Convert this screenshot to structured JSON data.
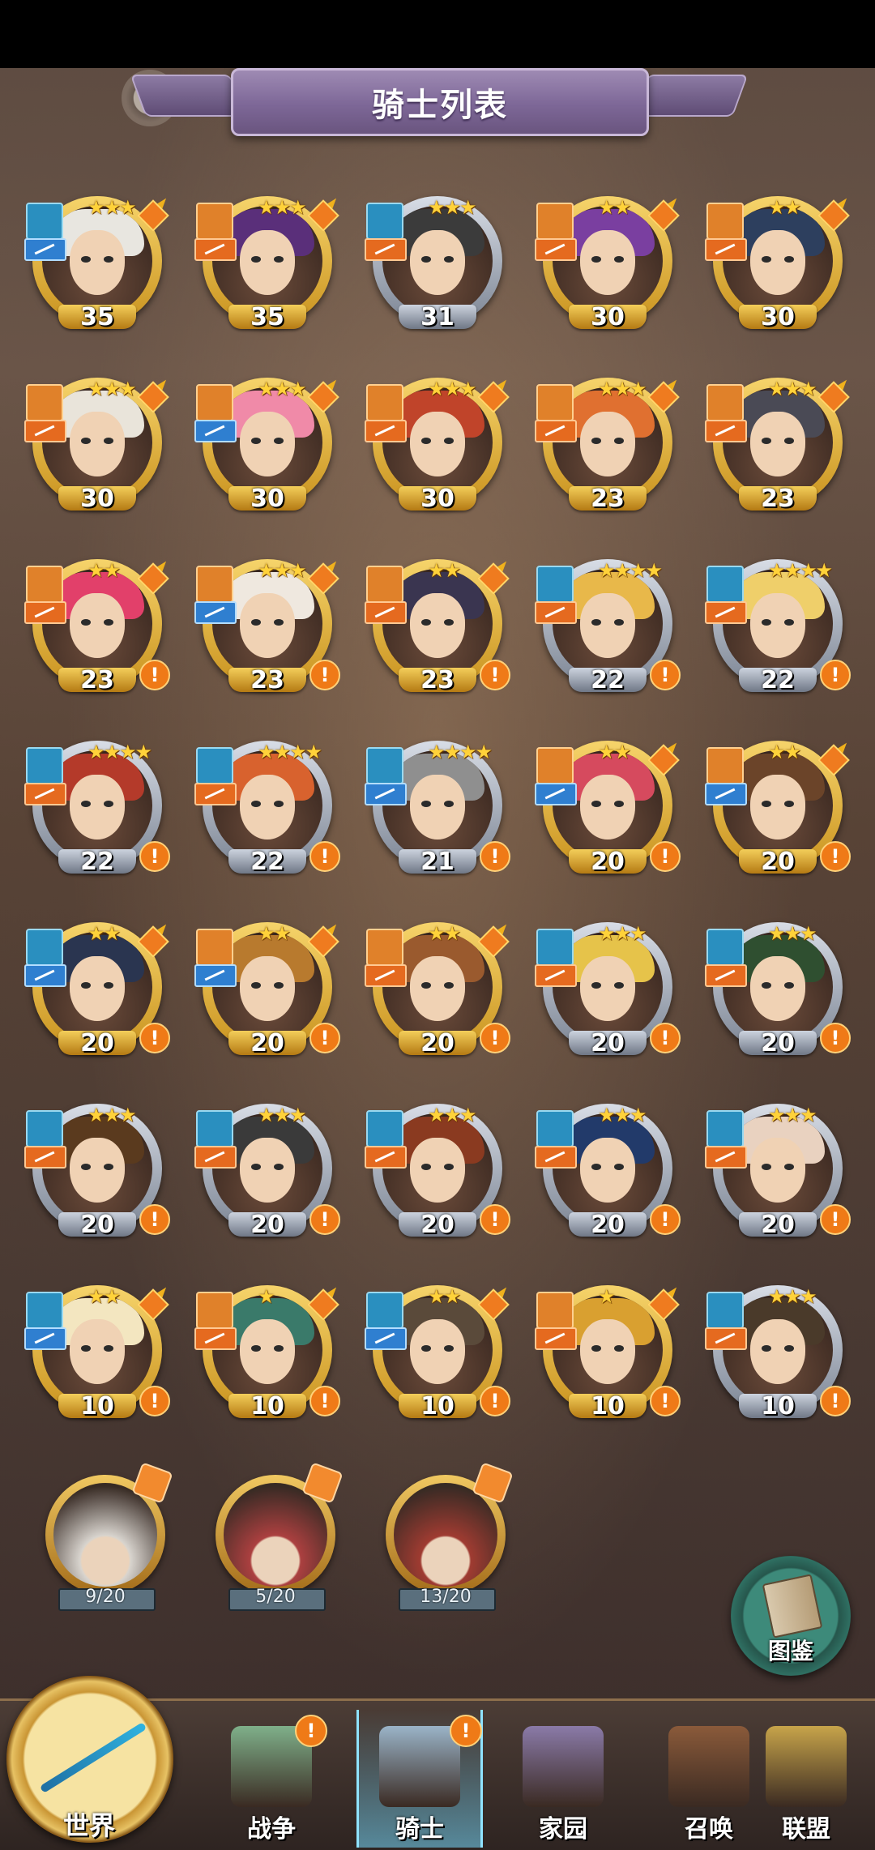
{
  "header": {
    "title": "骑士列表"
  },
  "heroes": [
    {
      "level": "35",
      "stars": "★★★",
      "alert": false,
      "frame": "gold",
      "hair": "#e8e6e0",
      "role": "blue",
      "cls": "blue"
    },
    {
      "level": "35",
      "stars": "★★★",
      "alert": false,
      "frame": "gold",
      "hair": "#5a2f7a",
      "role": "orange",
      "cls": "orange"
    },
    {
      "level": "31",
      "stars": "★★★",
      "alert": false,
      "frame": "silver",
      "hair": "#3b3b3b",
      "role": "blue",
      "cls": "orange"
    },
    {
      "level": "30",
      "stars": "★★",
      "alert": false,
      "frame": "gold",
      "hair": "#7a3fa0",
      "role": "orange",
      "cls": "orange"
    },
    {
      "level": "30",
      "stars": "★★",
      "alert": false,
      "frame": "gold",
      "hair": "#2d3f5e",
      "role": "orange",
      "cls": "orange"
    },
    {
      "level": "30",
      "stars": "★★★",
      "alert": false,
      "frame": "gold",
      "hair": "#e9e4da",
      "role": "orange",
      "cls": "orange"
    },
    {
      "level": "30",
      "stars": "★★★",
      "alert": false,
      "frame": "gold",
      "hair": "#f08aa8",
      "role": "orange",
      "cls": "blue"
    },
    {
      "level": "30",
      "stars": "★★★",
      "alert": false,
      "frame": "gold",
      "hair": "#c0442a",
      "role": "orange",
      "cls": "orange"
    },
    {
      "level": "23",
      "stars": "★★★",
      "alert": false,
      "frame": "gold",
      "hair": "#e07030",
      "role": "orange",
      "cls": "orange"
    },
    {
      "level": "23",
      "stars": "★★★",
      "alert": false,
      "frame": "gold",
      "hair": "#4a4a55",
      "role": "orange",
      "cls": "orange"
    },
    {
      "level": "23",
      "stars": "★★",
      "alert": true,
      "frame": "gold",
      "hair": "#e2406a",
      "role": "orange",
      "cls": "orange"
    },
    {
      "level": "23",
      "stars": "★★★",
      "alert": true,
      "frame": "gold",
      "hair": "#efe8df",
      "role": "orange",
      "cls": "blue"
    },
    {
      "level": "23",
      "stars": "★★",
      "alert": true,
      "frame": "gold",
      "hair": "#3a3550",
      "role": "orange",
      "cls": "orange"
    },
    {
      "level": "22",
      "stars": "★★★★",
      "alert": true,
      "frame": "silver",
      "hair": "#e8b84a",
      "role": "blue",
      "cls": "orange"
    },
    {
      "level": "22",
      "stars": "★★★★",
      "alert": true,
      "frame": "silver",
      "hair": "#efcf6a",
      "role": "blue",
      "cls": "orange"
    },
    {
      "level": "22",
      "stars": "★★★★",
      "alert": true,
      "frame": "silver",
      "hair": "#b43a2a",
      "role": "blue",
      "cls": "orange"
    },
    {
      "level": "22",
      "stars": "★★★★",
      "alert": true,
      "frame": "silver",
      "hair": "#d8622e",
      "role": "blue",
      "cls": "orange"
    },
    {
      "level": "21",
      "stars": "★★★★",
      "alert": true,
      "frame": "silver",
      "hair": "#8f8f8f",
      "role": "blue",
      "cls": "blue"
    },
    {
      "level": "20",
      "stars": "★★",
      "alert": true,
      "frame": "gold",
      "hair": "#d64a5e",
      "role": "orange",
      "cls": "blue"
    },
    {
      "level": "20",
      "stars": "★★",
      "alert": true,
      "frame": "gold",
      "hair": "#6b4429",
      "role": "orange",
      "cls": "blue"
    },
    {
      "level": "20",
      "stars": "★★",
      "alert": true,
      "frame": "gold",
      "hair": "#2a3550",
      "role": "blue",
      "cls": "blue"
    },
    {
      "level": "20",
      "stars": "★★",
      "alert": true,
      "frame": "gold",
      "hair": "#b87a2e",
      "role": "orange",
      "cls": "blue"
    },
    {
      "level": "20",
      "stars": "★★",
      "alert": true,
      "frame": "gold",
      "hair": "#9a5a2e",
      "role": "orange",
      "cls": "orange"
    },
    {
      "level": "20",
      "stars": "★★★",
      "alert": true,
      "frame": "silver",
      "hair": "#e6c34a",
      "role": "blue",
      "cls": "orange"
    },
    {
      "level": "20",
      "stars": "★★★",
      "alert": true,
      "frame": "silver",
      "hair": "#2f4f30",
      "role": "blue",
      "cls": "orange"
    },
    {
      "level": "20",
      "stars": "★★★",
      "alert": true,
      "frame": "silver",
      "hair": "#5a3a1e",
      "role": "blue",
      "cls": "orange"
    },
    {
      "level": "20",
      "stars": "★★★",
      "alert": true,
      "frame": "silver",
      "hair": "#3a3a3a",
      "role": "blue",
      "cls": "orange"
    },
    {
      "level": "20",
      "stars": "★★★",
      "alert": true,
      "frame": "silver",
      "hair": "#8a3a20",
      "role": "blue",
      "cls": "orange"
    },
    {
      "level": "20",
      "stars": "★★★",
      "alert": true,
      "frame": "silver",
      "hair": "#223a6a",
      "role": "blue",
      "cls": "orange"
    },
    {
      "level": "20",
      "stars": "★★★",
      "alert": true,
      "frame": "silver",
      "hair": "#e9d2c0",
      "role": "blue",
      "cls": "orange"
    },
    {
      "level": "10",
      "stars": "★★",
      "alert": true,
      "frame": "gold",
      "hair": "#f3e6c0",
      "role": "blue",
      "cls": "blue"
    },
    {
      "level": "10",
      "stars": "★",
      "alert": true,
      "frame": "gold",
      "hair": "#3a7a6a",
      "role": "orange",
      "cls": "orange"
    },
    {
      "level": "10",
      "stars": "★★",
      "alert": true,
      "frame": "gold",
      "hair": "#5a4a3a",
      "role": "blue",
      "cls": "blue"
    },
    {
      "level": "10",
      "stars": "★",
      "alert": true,
      "frame": "gold",
      "hair": "#d9a030",
      "role": "orange",
      "cls": "orange"
    },
    {
      "level": "10",
      "stars": "★★★",
      "alert": true,
      "frame": "silver",
      "hair": "#4a3a2a",
      "role": "blue",
      "cls": "orange"
    }
  ],
  "fragments": [
    {
      "progress": "9/20",
      "hair": "#d9d4cc"
    },
    {
      "progress": "5/20",
      "hair": "#c03a3a"
    },
    {
      "progress": "13/20",
      "hair": "#b3362a"
    }
  ],
  "codex": {
    "label": "图鉴"
  },
  "nav": {
    "world": "世界",
    "items": [
      {
        "label": "战争",
        "alert": true,
        "color": "#7fb08a"
      },
      {
        "label": "骑士",
        "alert": true,
        "color": "#9ab4c8"
      },
      {
        "label": "家园",
        "alert": false,
        "color": "#8a7aa8"
      },
      {
        "label": "召唤",
        "alert": false,
        "color": "#8a5a3a"
      },
      {
        "label": "联盟",
        "alert": false,
        "color": "#c7a44a"
      }
    ]
  },
  "colors": {
    "accent": "#ef7a17",
    "title_bar": "#7d6797",
    "gold": "#f0b11c"
  }
}
